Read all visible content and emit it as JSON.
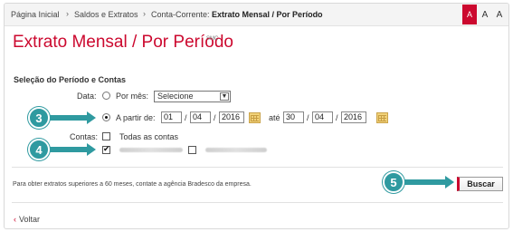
{
  "breadcrumb": {
    "items": [
      "Página Inicial",
      "Saldos e Extratos"
    ],
    "current_prefix": "Conta-Corrente: ",
    "current_title": "Extrato Mensal / Por Período",
    "separator": "›"
  },
  "font_size_controls": [
    "A",
    "A",
    "A"
  ],
  "page": {
    "title": "Extrato Mensal / Por Período",
    "title_sup": "SMC",
    "section_title": "Seleção do Período e Contas"
  },
  "form": {
    "data_label": "Data:",
    "por_mes_label": "Por mês:",
    "por_mes_select_value": "Selecione",
    "a_partir_label": "A partir de:",
    "from_day": "01",
    "from_month": "04",
    "from_year": "2016",
    "ate_label": "até",
    "to_day": "30",
    "to_month": "04",
    "to_year": "2016",
    "date_separator": "/",
    "contas_label": "Contas:",
    "todas_contas_label": "Todas as contas",
    "selected_period_option": "a_partir"
  },
  "footer": {
    "note": "Para obter extratos superiores a 60 meses, contate a agência Bradesco da empresa.",
    "buscar_label": "Buscar",
    "voltar_label": "Voltar",
    "voltar_icon": "‹"
  },
  "callouts": [
    "3",
    "4",
    "5"
  ],
  "colors": {
    "brand_red": "#cc092f",
    "callout_teal": "#2f9aa0",
    "calendar_yellow": "#f1d27a"
  }
}
